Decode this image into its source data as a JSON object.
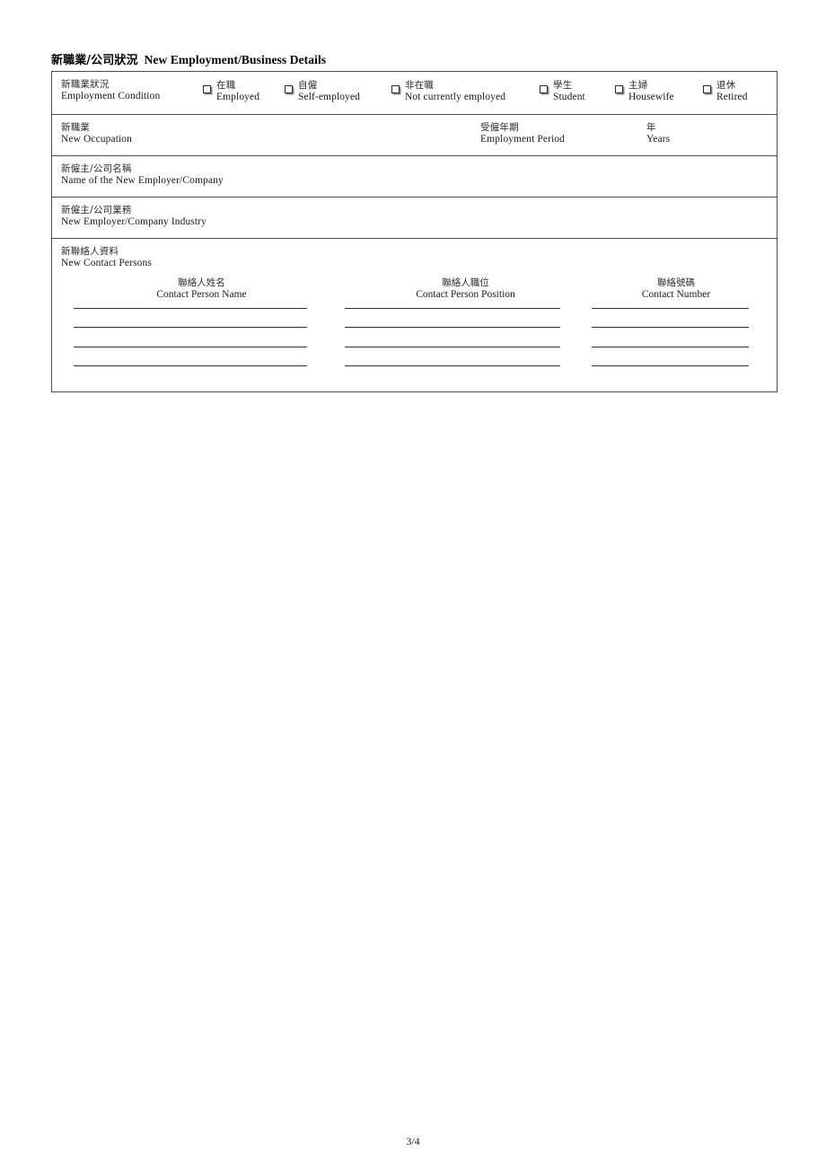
{
  "page": {
    "page_number": "3/4"
  },
  "section": {
    "heading_zh": "新職業/公司狀況",
    "heading_en": "New Employment/Business Details"
  },
  "rows": {
    "employment_condition": {
      "label_zh": "新職業狀況",
      "label_en": "Employment Condition",
      "options": [
        {
          "zh": "在職",
          "en": "Employed",
          "checked": false
        },
        {
          "zh": "自僱",
          "en": "Self-employed",
          "checked": false
        },
        {
          "zh": "非在職",
          "en": "Not currently employed",
          "checked": false
        },
        {
          "zh": "學生",
          "en": "Student",
          "checked": false
        },
        {
          "zh": "主婦",
          "en": "Housewife",
          "checked": false
        },
        {
          "zh": "退休",
          "en": "Retired",
          "checked": false
        }
      ]
    },
    "new_occupation": {
      "label_zh": "新職業",
      "label_en": "New Occupation",
      "value": "",
      "employment_period_zh": "受僱年期",
      "employment_period_en": "Employment Period",
      "period_value": "",
      "years_zh": "年",
      "years_en": "Years"
    },
    "employer_name": {
      "label_zh": "新僱主/公司名稱",
      "label_en": "Name of the New Employer/Company",
      "value": ""
    },
    "employer_industry": {
      "label_zh": "新僱主/公司業務",
      "label_en": "New Employer/Company Industry",
      "value": ""
    },
    "contact_persons": {
      "label_zh": "新聯絡人資料",
      "label_en": "New Contact Persons",
      "columns": [
        {
          "zh": "聯絡人姓名",
          "en": "Contact Person Name"
        },
        {
          "zh": "聯絡人職位",
          "en": "Contact Person Position"
        },
        {
          "zh": "聯絡號碼",
          "en": "Contact Number"
        }
      ],
      "entries": [
        {
          "name": "",
          "position": "",
          "number": ""
        },
        {
          "name": "",
          "position": "",
          "number": ""
        },
        {
          "name": "",
          "position": "",
          "number": ""
        },
        {
          "name": "",
          "position": "",
          "number": ""
        }
      ]
    }
  },
  "colors": {
    "border": "#4b4b52",
    "rule_line": "#3a3036",
    "text": "#1a1a1a",
    "zh_text": "#2c2c2c"
  }
}
